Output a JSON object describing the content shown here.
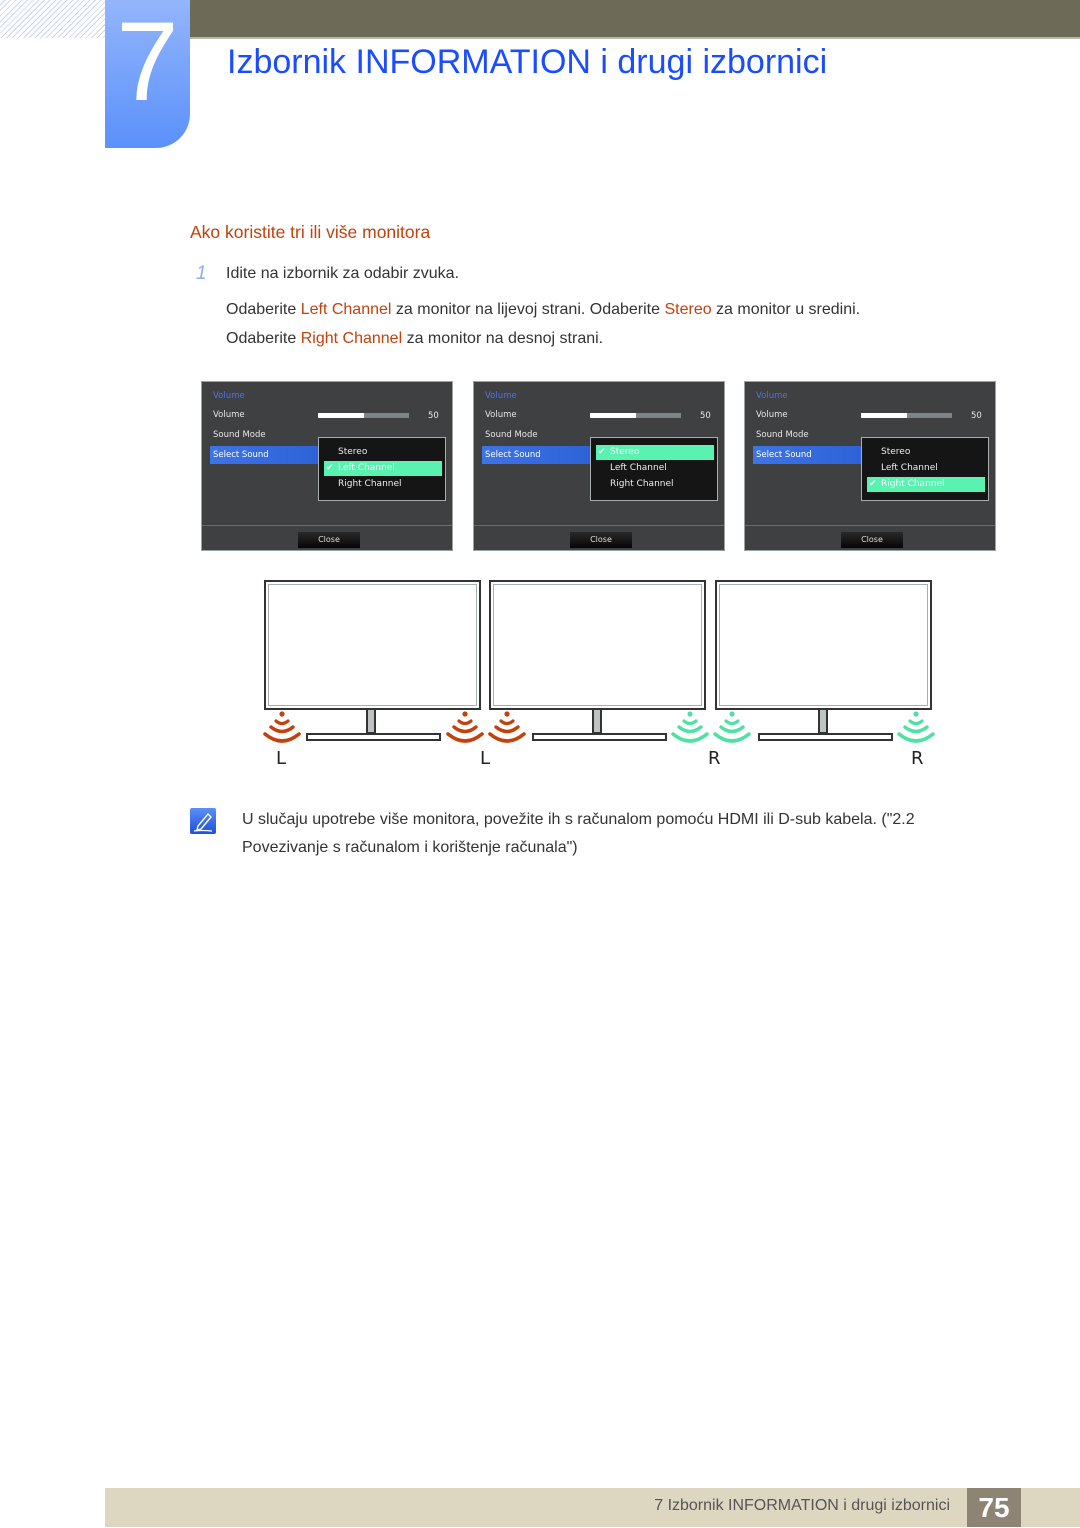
{
  "chapter": {
    "number": "7",
    "title": "Izbornik INFORMATION i drugi izbornici"
  },
  "section": {
    "title": "Ako koristite tri ili više monitora"
  },
  "steps": [
    {
      "number": "1",
      "text": "Idite na izbornik za odabir zvuka."
    }
  ],
  "instructions": {
    "line1": {
      "p1": "Odaberite ",
      "h1": "Left Channel",
      "p2": " za monitor na lijevoj strani. Odaberite ",
      "h2": "Stereo",
      "p3": " za monitor u sredini."
    },
    "line2": {
      "p1": "Odaberite ",
      "h1": "Right Channel",
      "p2": " za monitor na desnoj strani."
    }
  },
  "osd_panels": [
    {
      "title": "Volume",
      "rows": [
        "Volume",
        "Sound Mode",
        "Select Sound"
      ],
      "volume_value": "50",
      "volume_fraction": 0.5,
      "options": [
        "Stereo",
        "Left Channel",
        "Right Channel"
      ],
      "selected_option": "Left Channel",
      "check": "✔",
      "close_label": "Close"
    },
    {
      "title": "Volume",
      "rows": [
        "Volume",
        "Sound Mode",
        "Select Sound"
      ],
      "volume_value": "50",
      "volume_fraction": 0.5,
      "options": [
        "Stereo",
        "Left Channel",
        "Right Channel"
      ],
      "selected_option": "Stereo",
      "check": "✔",
      "close_label": "Close"
    },
    {
      "title": "Volume",
      "rows": [
        "Volume",
        "Sound Mode",
        "Select Sound"
      ],
      "volume_value": "50",
      "volume_fraction": 0.5,
      "options": [
        "Stereo",
        "Left Channel",
        "Right Channel"
      ],
      "selected_option": "Right Channel",
      "check": "✔",
      "close_label": "Close"
    }
  ],
  "diagram": {
    "channel_labels": [
      "L",
      "L",
      "R",
      "R"
    ],
    "left_color": "#c2410c",
    "right_color": "#4fe0a4"
  },
  "note": {
    "icon": "note-pencil-icon",
    "text": "U slučaju upotrebe više monitora, povežite ih s računalom pomoću HDMI ili D-sub kabela. (\"2.2 Povezivanje s računalom i korištenje računala\")"
  },
  "footer": {
    "text": "7 Izbornik INFORMATION i drugi izbornici",
    "page": "75"
  },
  "colors": {
    "chapter_blue": "#1a4dff",
    "section_orange": "#c2410c",
    "osd_highlight": "#5af2b0",
    "osd_select_blue": "#3d74e6"
  }
}
